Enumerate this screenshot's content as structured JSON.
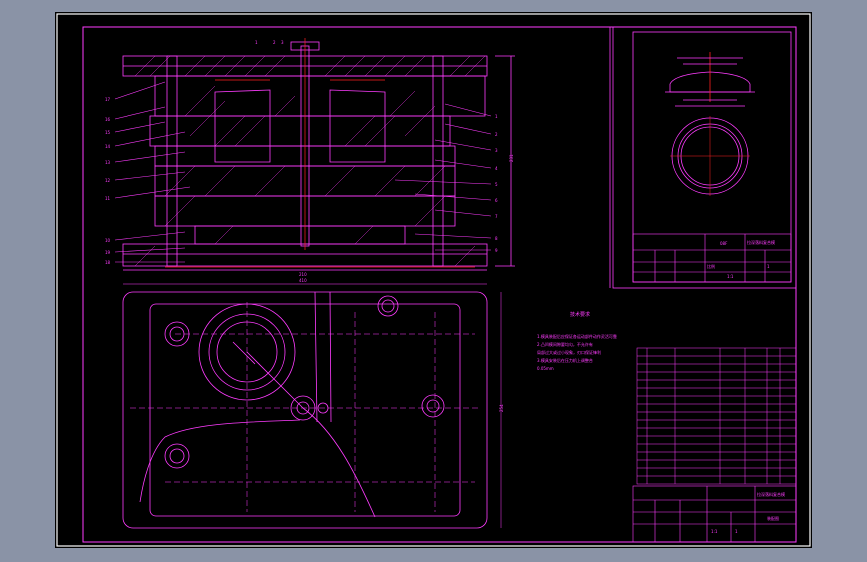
{
  "labels": {
    "left_callouts": [
      "17",
      "16",
      "15",
      "14",
      "13",
      "12",
      "11",
      "10",
      "19",
      "18"
    ],
    "right_callouts": [
      "1",
      "2",
      "3",
      "4",
      "5",
      "6",
      "7",
      "8",
      "9",
      "10",
      "11"
    ],
    "top_callouts": [
      "1",
      "2",
      "3"
    ],
    "dim_total_width": "210",
    "dim_height": "231",
    "dim_plan_width": "410",
    "dim_plan_height": "254",
    "tech_title": "技术要求",
    "tech_notes": [
      "1.模具装配后应保证各运动部件动作灵活可靠",
      "2.凸凹模间隙要均匀，不允许有",
      "  局部过大或过小现象，刃口保证锋利",
      "3.模具安装后在压力机上调整合",
      "  0.05mm"
    ],
    "part_title_block": {
      "part_name": "拉深落料复合模",
      "scale_label": "比例",
      "scale": "1:1",
      "material": "08F",
      "qty": "1"
    },
    "main_title_block": {
      "drawing_name": "拉深落料复合模",
      "drawing_no": "装配图",
      "scale": "1:1",
      "sheet": "1"
    }
  },
  "bom_rows": 17,
  "colors": {
    "line": "#ff3cff",
    "red": "#ff2020",
    "frame": "#ffffff"
  }
}
